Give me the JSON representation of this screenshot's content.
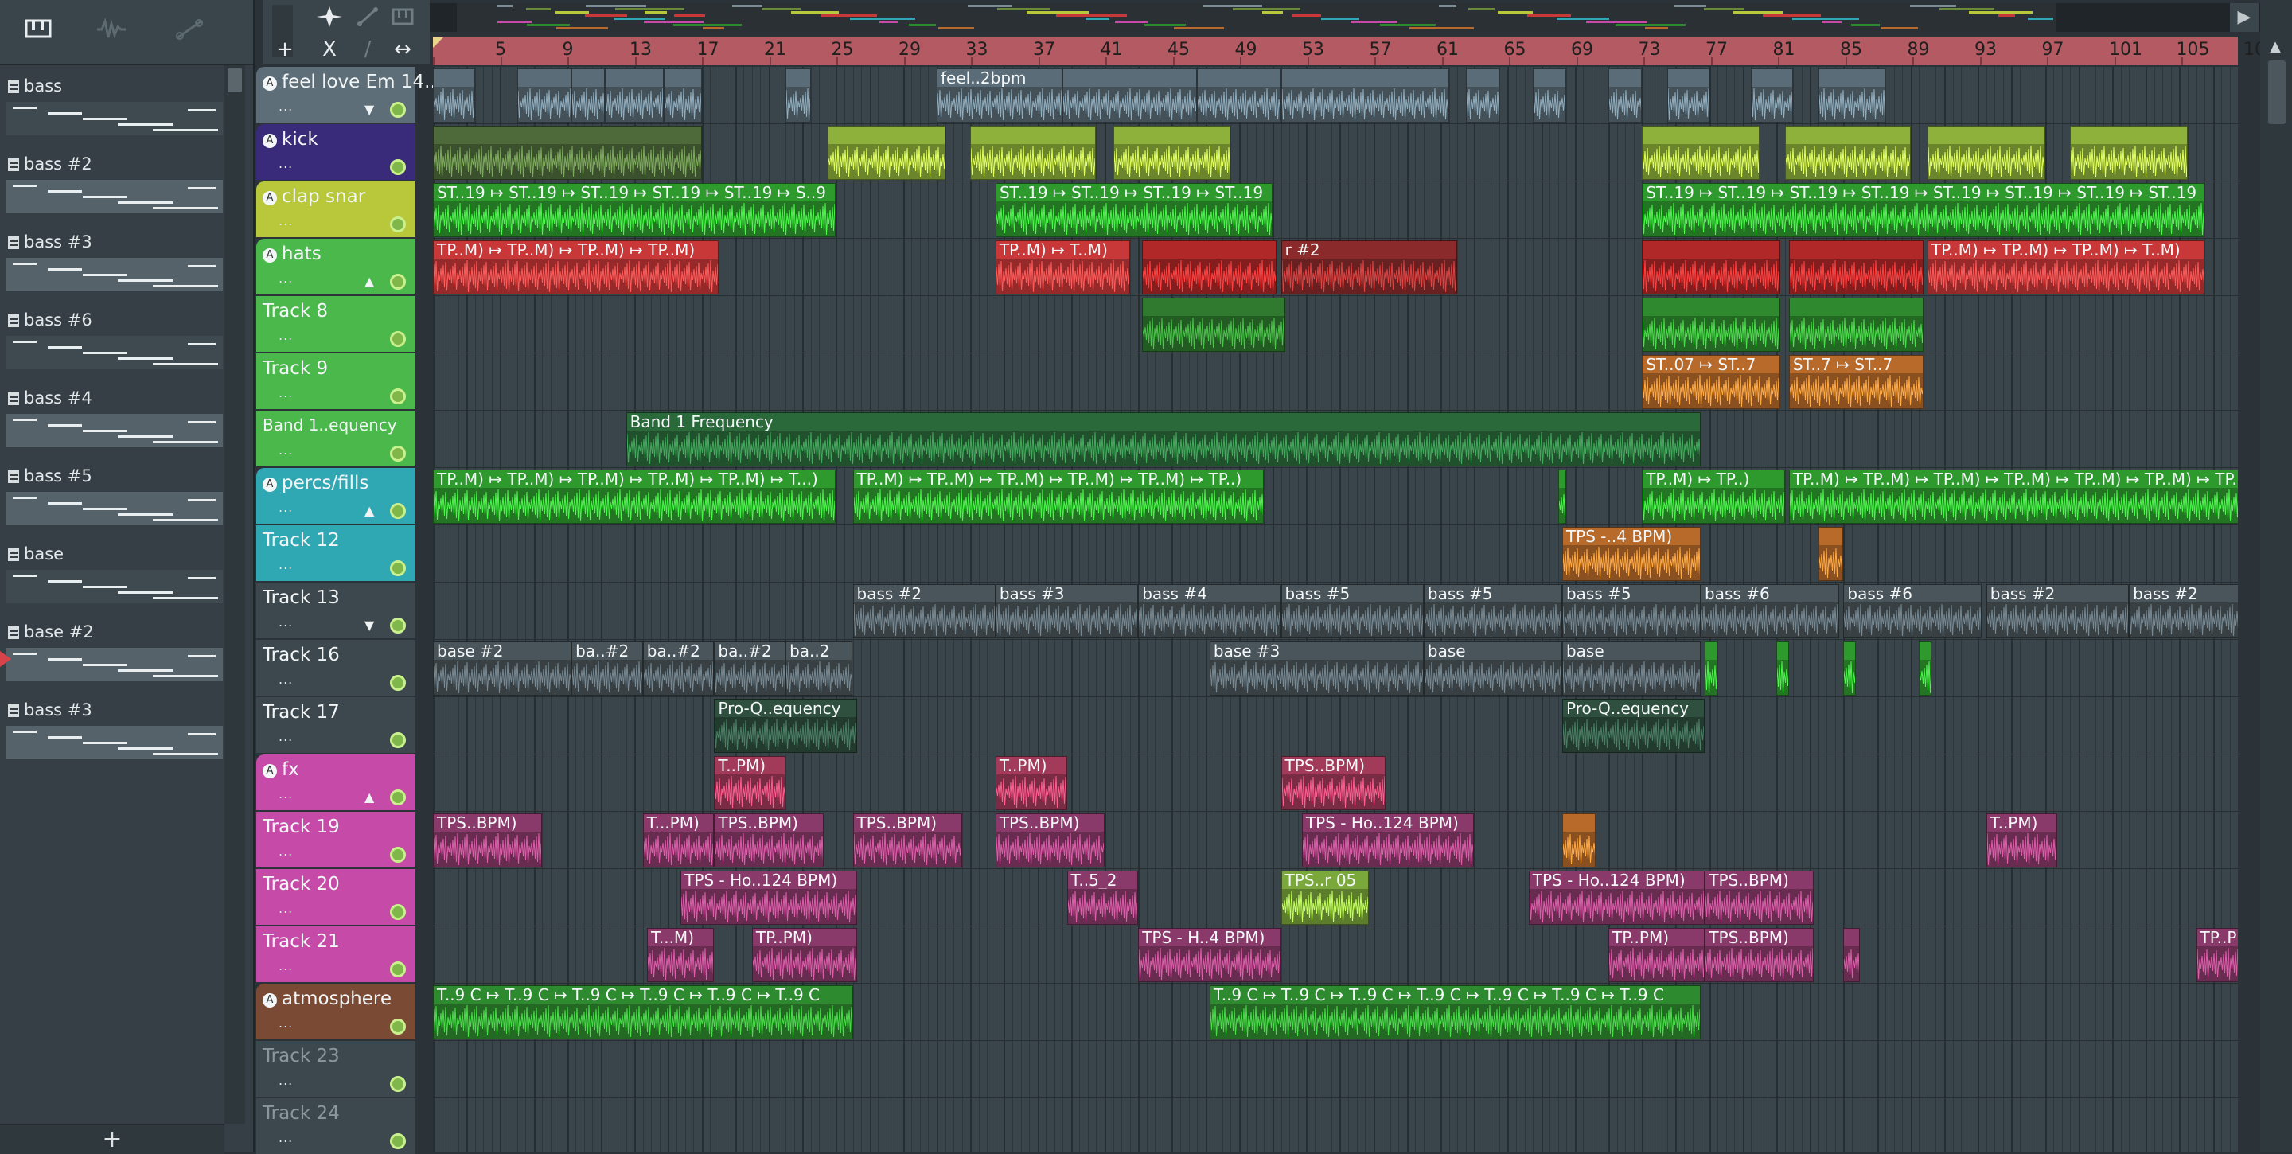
{
  "browser": {
    "toolbar_icons": [
      "piano-roll-icon",
      "waveform-icon",
      "automation-icon"
    ],
    "patterns": [
      {
        "label": "bass",
        "selected": false
      },
      {
        "label": "bass #2",
        "selected": false
      },
      {
        "label": "bass #3",
        "selected": false
      },
      {
        "label": "bass #6",
        "selected": false
      },
      {
        "label": "bass #4",
        "selected": false
      },
      {
        "label": "bass #5",
        "selected": false
      },
      {
        "label": "base",
        "selected": false
      },
      {
        "label": "base #2",
        "selected": true
      },
      {
        "label": "bass #3",
        "selected": false
      }
    ],
    "add_label": "+"
  },
  "tools": {
    "add": "+",
    "close": "X",
    "snap": "∕",
    "stretch": "↔"
  },
  "ruler": {
    "bars": [
      "5",
      "9",
      "13",
      "17",
      "21",
      "25",
      "29",
      "33",
      "37",
      "41",
      "45",
      "49",
      "53",
      "57",
      "61",
      "65",
      "69",
      "73",
      "77",
      "81",
      "85",
      "89",
      "93",
      "97",
      "101",
      "105",
      "10"
    ]
  },
  "tracks": [
    {
      "name": "feel love Em 14..",
      "color": "#5d6e78",
      "has_key": true,
      "dim": false
    },
    {
      "name": "kick",
      "color": "#3a2a7a",
      "has_key": true,
      "dim": false
    },
    {
      "name": "clap snar",
      "color": "#b8c83a",
      "has_key": true,
      "dim": false
    },
    {
      "name": "hats",
      "color": "#4bb84b",
      "has_key": true,
      "dim": false
    },
    {
      "name": "Track 8",
      "color": "#4bb84b",
      "has_key": false,
      "dim": false
    },
    {
      "name": "Track 9",
      "color": "#4bb84b",
      "has_key": false,
      "dim": false
    },
    {
      "name": "Band 1..equency",
      "color": "#4bb84b",
      "has_key": false,
      "dim": false
    },
    {
      "name": "percs/fills",
      "color": "#2fa8b3",
      "has_key": true,
      "dim": false
    },
    {
      "name": "Track 12",
      "color": "#2fa8b3",
      "has_key": false,
      "dim": false
    },
    {
      "name": "Track 13",
      "color": "#3d484e",
      "has_key": false,
      "dim": false
    },
    {
      "name": "Track 16",
      "color": "#3d484e",
      "has_key": false,
      "dim": false
    },
    {
      "name": "Track 17",
      "color": "#3d484e",
      "has_key": false,
      "dim": false
    },
    {
      "name": "fx",
      "color": "#c64aa8",
      "has_key": true,
      "dim": false
    },
    {
      "name": "Track 19",
      "color": "#c64aa8",
      "has_key": false,
      "dim": false
    },
    {
      "name": "Track 20",
      "color": "#c64aa8",
      "has_key": false,
      "dim": false
    },
    {
      "name": "Track 21",
      "color": "#c64aa8",
      "has_key": false,
      "dim": false
    },
    {
      "name": "atmosphere",
      "color": "#7a4a34",
      "has_key": true,
      "dim": false
    },
    {
      "name": "Track 23",
      "color": "#3d484e",
      "has_key": false,
      "dim": true
    },
    {
      "name": "Track 24",
      "color": "#3d484e",
      "has_key": false,
      "dim": true
    }
  ],
  "clips": [
    {
      "row": 0,
      "start": 0.0,
      "len": 5.0,
      "label": "",
      "color": "#5a6c77"
    },
    {
      "row": 0,
      "start": 10.0,
      "len": 7.0,
      "label": "",
      "color": "#5a6c77"
    },
    {
      "row": 0,
      "start": 16.5,
      "len": 4.0,
      "label": "",
      "color": "#5a6c77"
    },
    {
      "row": 0,
      "start": 20.5,
      "len": 7.0,
      "label": "",
      "color": "#5a6c77"
    },
    {
      "row": 0,
      "start": 27.5,
      "len": 4.5,
      "label": "",
      "color": "#5a6c77"
    },
    {
      "row": 0,
      "start": 42.0,
      "len": 3.0,
      "label": "",
      "color": "#5a6c77"
    },
    {
      "row": 0,
      "start": 60.0,
      "len": 15.0,
      "label": "feel..2bpm",
      "color": "#5a6c77"
    },
    {
      "row": 0,
      "start": 75.0,
      "len": 16.0,
      "label": "",
      "color": "#5a6c77"
    },
    {
      "row": 0,
      "start": 91.0,
      "len": 10.0,
      "label": "",
      "color": "#5a6c77"
    },
    {
      "row": 0,
      "start": 101.0,
      "len": 20.0,
      "label": "",
      "color": "#5a6c77"
    },
    {
      "row": 0,
      "start": 123.0,
      "len": 4.0,
      "label": "",
      "color": "#5a6c77"
    },
    {
      "row": 0,
      "start": 131.0,
      "len": 4.0,
      "label": "",
      "color": "#5a6c77"
    },
    {
      "row": 0,
      "start": 140.0,
      "len": 4.0,
      "label": "",
      "color": "#5a6c77"
    },
    {
      "row": 0,
      "start": 147.0,
      "len": 5.0,
      "label": "",
      "color": "#5a6c77"
    },
    {
      "row": 0,
      "start": 157.0,
      "len": 5.0,
      "label": "",
      "color": "#5a6c77"
    },
    {
      "row": 0,
      "start": 165.0,
      "len": 8.0,
      "label": "",
      "color": "#5a6c77"
    },
    {
      "row": 1,
      "start": 0.0,
      "len": 32.0,
      "label": "",
      "color": "#4f6a3a"
    },
    {
      "row": 1,
      "start": 47.0,
      "len": 14.0,
      "label": "",
      "color": "#8db13a"
    },
    {
      "row": 1,
      "start": 64.0,
      "len": 15.0,
      "label": "",
      "color": "#8db13a"
    },
    {
      "row": 1,
      "start": 81.0,
      "len": 14.0,
      "label": "",
      "color": "#8db13a"
    },
    {
      "row": 1,
      "start": 144.0,
      "len": 14.0,
      "label": "",
      "color": "#8db13a"
    },
    {
      "row": 1,
      "start": 161.0,
      "len": 15.0,
      "label": "",
      "color": "#8db13a"
    },
    {
      "row": 1,
      "start": 178.0,
      "len": 14.0,
      "label": "",
      "color": "#8db13a"
    },
    {
      "row": 1,
      "start": 195.0,
      "len": 14.0,
      "label": "",
      "color": "#8db13a"
    },
    {
      "row": 2,
      "start": 0.0,
      "len": 48.0,
      "label": "ST..19 ↦ ST..19 ↦ ST..19 ↦ ST..19 ↦ ST..19 ↦ S..9",
      "color": "#2e9a2e"
    },
    {
      "row": 2,
      "start": 67.0,
      "len": 33.0,
      "label": "ST..19 ↦ ST..19 ↦ ST..19 ↦ ST..19",
      "color": "#2e9a2e"
    },
    {
      "row": 2,
      "start": 144.0,
      "len": 67.0,
      "label": "ST..19 ↦ ST..19 ↦ ST..19 ↦ ST..19 ↦ ST..19 ↦ ST..19 ↦ ST..19 ↦ ST..19",
      "color": "#2e9a2e"
    },
    {
      "row": 3,
      "start": 0.0,
      "len": 34.0,
      "label": "TP..M) ↦ TP..M) ↦ TP..M) ↦ TP..M)",
      "color": "#c83838"
    },
    {
      "row": 3,
      "start": 67.0,
      "len": 16.0,
      "label": "TP..M) ↦ T..M)",
      "color": "#c83838"
    },
    {
      "row": 3,
      "start": 84.5,
      "len": 16.0,
      "label": "",
      "color": "#b02828"
    },
    {
      "row": 3,
      "start": 101.0,
      "len": 21.0,
      "label": "r #2",
      "color": "#8a2a2a"
    },
    {
      "row": 3,
      "start": 144.0,
      "len": 16.5,
      "label": "",
      "color": "#b02828"
    },
    {
      "row": 3,
      "start": 161.5,
      "len": 16.0,
      "label": "",
      "color": "#b02828"
    },
    {
      "row": 3,
      "start": 178.0,
      "len": 33.0,
      "label": "TP..M) ↦ TP..M) ↦ TP..M) ↦ T..M)",
      "color": "#c83838"
    },
    {
      "row": 4,
      "start": 84.5,
      "len": 17.0,
      "label": "",
      "color": "#2f7a2f"
    },
    {
      "row": 4,
      "start": 144.0,
      "len": 16.5,
      "label": "",
      "color": "#2f8a2f"
    },
    {
      "row": 4,
      "start": 161.5,
      "len": 16.0,
      "label": "",
      "color": "#2f8a2f"
    },
    {
      "row": 5,
      "start": 144.0,
      "len": 16.5,
      "label": "ST..07 ↦ ST..7",
      "color": "#b86a2a"
    },
    {
      "row": 5,
      "start": 161.5,
      "len": 16.0,
      "label": "ST..7 ↦ ST..7",
      "color": "#b86a2a"
    },
    {
      "row": 6,
      "start": 23.0,
      "len": 128.0,
      "label": "Band 1 Frequency",
      "color": "#2a6a3a"
    },
    {
      "row": 7,
      "start": 0.0,
      "len": 48.0,
      "label": "TP..M) ↦ TP..M) ↦ TP..M) ↦ TP..M) ↦ TP..M) ↦ T...)",
      "color": "#2e9a2e"
    },
    {
      "row": 7,
      "start": 50.0,
      "len": 49.0,
      "label": "TP..M) ↦ TP..M) ↦ TP..M) ↦ TP..M) ↦ TP..M) ↦ TP..)",
      "color": "#2e9a2e"
    },
    {
      "row": 7,
      "start": 134.0,
      "len": 1.0,
      "label": "",
      "color": "#2e9a2e"
    },
    {
      "row": 7,
      "start": 144.0,
      "len": 17.0,
      "label": "TP..M) ↦ TP..)",
      "color": "#2e9a2e"
    },
    {
      "row": 7,
      "start": 161.5,
      "len": 68.0,
      "label": "TP..M) ↦ TP..M) ↦ TP..M) ↦ TP..M) ↦ TP..M) ↦ TP..M) ↦ TP..M)",
      "color": "#2e9a2e"
    },
    {
      "row": 8,
      "start": 134.5,
      "len": 16.5,
      "label": "TPS -..4 BPM)",
      "color": "#b86a2a"
    },
    {
      "row": 8,
      "start": 165.0,
      "len": 3.0,
      "label": "",
      "color": "#b86a2a"
    },
    {
      "row": 9,
      "start": 50.0,
      "len": 17.0,
      "label": "bass #2",
      "color": "#4a555b"
    },
    {
      "row": 9,
      "start": 67.0,
      "len": 17.0,
      "label": "bass #3",
      "color": "#4a555b"
    },
    {
      "row": 9,
      "start": 84.0,
      "len": 17.0,
      "label": "bass #4",
      "color": "#4a555b"
    },
    {
      "row": 9,
      "start": 101.0,
      "len": 17.0,
      "label": "bass #5",
      "color": "#4a555b"
    },
    {
      "row": 9,
      "start": 118.0,
      "len": 16.5,
      "label": "bass #5",
      "color": "#4a555b"
    },
    {
      "row": 9,
      "start": 134.5,
      "len": 16.5,
      "label": "bass #5",
      "color": "#4a555b"
    },
    {
      "row": 9,
      "start": 151.0,
      "len": 16.5,
      "label": "bass #6",
      "color": "#4a555b"
    },
    {
      "row": 9,
      "start": 168.0,
      "len": 16.5,
      "label": "bass #6",
      "color": "#4a555b"
    },
    {
      "row": 9,
      "start": 185.0,
      "len": 17.0,
      "label": "bass #2",
      "color": "#4a555b"
    },
    {
      "row": 9,
      "start": 202.0,
      "len": 16.5,
      "label": "bass #2",
      "color": "#4a555b"
    },
    {
      "row": 10,
      "start": 0.0,
      "len": 16.5,
      "label": "base #2",
      "color": "#4a555b"
    },
    {
      "row": 10,
      "start": 16.5,
      "len": 8.5,
      "label": "ba..#2",
      "color": "#4a555b"
    },
    {
      "row": 10,
      "start": 25.0,
      "len": 8.5,
      "label": "ba..#2",
      "color": "#4a555b"
    },
    {
      "row": 10,
      "start": 33.5,
      "len": 8.5,
      "label": "ba..#2",
      "color": "#4a555b"
    },
    {
      "row": 10,
      "start": 42.0,
      "len": 8.0,
      "label": "ba..2",
      "color": "#4a555b"
    },
    {
      "row": 10,
      "start": 92.5,
      "len": 25.5,
      "label": "base #3",
      "color": "#4a555b"
    },
    {
      "row": 10,
      "start": 118.0,
      "len": 16.5,
      "label": "base",
      "color": "#4a555b"
    },
    {
      "row": 10,
      "start": 134.5,
      "len": 16.5,
      "label": "base",
      "color": "#4a555b"
    },
    {
      "row": 10,
      "start": 151.5,
      "len": 1.5,
      "label": "",
      "color": "#2e9a2e"
    },
    {
      "row": 10,
      "start": 160.0,
      "len": 1.5,
      "label": "",
      "color": "#2e9a2e"
    },
    {
      "row": 10,
      "start": 168.0,
      "len": 1.5,
      "label": "",
      "color": "#2e9a2e"
    },
    {
      "row": 10,
      "start": 177.0,
      "len": 1.5,
      "label": "",
      "color": "#2e9a2e"
    },
    {
      "row": 11,
      "start": 33.5,
      "len": 17.0,
      "label": "Pro-Q..equency",
      "color": "#2f4f3f"
    },
    {
      "row": 11,
      "start": 134.5,
      "len": 17.0,
      "label": "Pro-Q..equency",
      "color": "#2f4f3f"
    },
    {
      "row": 12,
      "start": 33.5,
      "len": 8.5,
      "label": "T..PM)",
      "color": "#a23a5a"
    },
    {
      "row": 12,
      "start": 67.0,
      "len": 8.5,
      "label": "T..PM)",
      "color": "#a23a5a"
    },
    {
      "row": 12,
      "start": 101.0,
      "len": 12.5,
      "label": "TPS..BPM)",
      "color": "#a23a5a"
    },
    {
      "row": 13,
      "start": 0.0,
      "len": 13.0,
      "label": "TPS..BPM)",
      "color": "#8a3a6a"
    },
    {
      "row": 13,
      "start": 25.0,
      "len": 8.5,
      "label": "T...PM)",
      "color": "#8a3a6a"
    },
    {
      "row": 13,
      "start": 33.5,
      "len": 13.0,
      "label": "TPS..BPM)",
      "color": "#8a3a6a"
    },
    {
      "row": 13,
      "start": 50.0,
      "len": 13.0,
      "label": "TPS..BPM)",
      "color": "#8a3a6a"
    },
    {
      "row": 13,
      "start": 67.0,
      "len": 13.0,
      "label": "TPS..BPM)",
      "color": "#8a3a6a"
    },
    {
      "row": 13,
      "start": 103.5,
      "len": 20.5,
      "label": "TPS - Ho..124 BPM)",
      "color": "#8a3a6a"
    },
    {
      "row": 13,
      "start": 134.5,
      "len": 4.0,
      "label": "",
      "color": "#b86a2a"
    },
    {
      "row": 13,
      "start": 185.0,
      "len": 8.5,
      "label": "T..PM)",
      "color": "#8a3a6a"
    },
    {
      "row": 13,
      "start": 218.5,
      "len": 8.5,
      "label": "T..PM)",
      "color": "#8a3a6a"
    },
    {
      "row": 14,
      "start": 29.5,
      "len": 21.0,
      "label": "TPS - Ho..124 BPM)",
      "color": "#8a3a6a"
    },
    {
      "row": 14,
      "start": 75.5,
      "len": 8.5,
      "label": "T..5_2",
      "color": "#8a3a6a"
    },
    {
      "row": 14,
      "start": 101.0,
      "len": 10.5,
      "label": "TPS..r 05",
      "color": "#7aa83a"
    },
    {
      "row": 14,
      "start": 130.5,
      "len": 21.0,
      "label": "TPS - Ho..124 BPM)",
      "color": "#8a3a6a"
    },
    {
      "row": 14,
      "start": 151.5,
      "len": 13.0,
      "label": "TPS..BPM)",
      "color": "#8a3a6a"
    },
    {
      "row": 15,
      "start": 25.5,
      "len": 8.0,
      "label": "T...M)",
      "color": "#8a3a6a"
    },
    {
      "row": 15,
      "start": 38.0,
      "len": 12.5,
      "label": "TP..PM)",
      "color": "#8a3a6a"
    },
    {
      "row": 15,
      "start": 84.0,
      "len": 17.0,
      "label": "TPS - H..4 BPM)",
      "color": "#8a3a6a"
    },
    {
      "row": 15,
      "start": 140.0,
      "len": 11.5,
      "label": "TP..PM)",
      "color": "#8a3a6a"
    },
    {
      "row": 15,
      "start": 151.5,
      "len": 13.0,
      "label": "TPS..BPM)",
      "color": "#8a3a6a"
    },
    {
      "row": 15,
      "start": 168.0,
      "len": 2.0,
      "label": "",
      "color": "#8a3a6a"
    },
    {
      "row": 15,
      "start": 210.0,
      "len": 10.0,
      "label": "TP..PM)",
      "color": "#8a3a6a"
    },
    {
      "row": 16,
      "start": 0.0,
      "len": 50.0,
      "label": "T..9 C ↦ T..9 C ↦ T..9 C ↦ T..9 C ↦ T..9 C ↦ T..9 C",
      "color": "#2e8a2e"
    },
    {
      "row": 16,
      "start": 92.5,
      "len": 58.5,
      "label": "T..9 C ↦ T..9 C ↦ T..9 C ↦ T..9 C ↦ T..9 C ↦ T..9 C ↦ T..9 C",
      "color": "#2e8a2e"
    }
  ]
}
